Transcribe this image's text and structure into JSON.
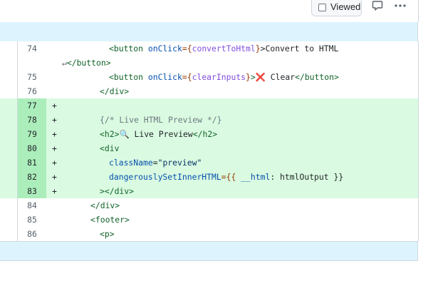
{
  "header": {
    "viewed_label": "Viewed",
    "comment_icon": "comment-icon",
    "kebab_icon": "kebab-horizontal-icon"
  },
  "colors": {
    "added_bg": "#dafbe1",
    "added_lineno_bg": "#aceebb",
    "hunk_bg": "#ddf4ff",
    "border": "#d0d7de"
  },
  "rows": [
    {
      "no": "74",
      "marker": "",
      "added": false,
      "tokens": [
        {
          "t": "<",
          "c": "tag"
        },
        {
          "t": "button",
          "c": "tag"
        },
        {
          "t": " onClick",
          "c": "attr"
        },
        {
          "t": "={",
          "c": "expr"
        },
        {
          "t": "convertToHtml",
          "c": "var"
        },
        {
          "t": "}",
          "c": "expr"
        },
        {
          "t": ">Convert to HTML",
          "c": "default"
        }
      ]
    },
    {
      "no": "",
      "marker": "",
      "added": false,
      "continuation": true,
      "tokens": [
        {
          "t": "↵",
          "c": "arrow"
        },
        {
          "t": "</button>",
          "c": "tag"
        }
      ]
    },
    {
      "no": "75",
      "marker": "",
      "added": false,
      "tokens": [
        {
          "t": "<",
          "c": "tag"
        },
        {
          "t": "button",
          "c": "tag"
        },
        {
          "t": " onClick",
          "c": "attr"
        },
        {
          "t": "={",
          "c": "expr"
        },
        {
          "t": "clearInputs",
          "c": "var"
        },
        {
          "t": "}",
          "c": "expr"
        },
        {
          "t": ">",
          "c": "tag"
        },
        {
          "t": "❌",
          "c": "red"
        },
        {
          "t": " Clear",
          "c": "default"
        },
        {
          "t": "</button>",
          "c": "tag"
        }
      ]
    },
    {
      "no": "76",
      "marker": "",
      "added": false,
      "tokens": [
        {
          "t": "</div>",
          "c": "tag"
        }
      ]
    },
    {
      "no": "77",
      "marker": "+",
      "added": true,
      "tokens": []
    },
    {
      "no": "78",
      "marker": "+",
      "added": true,
      "tokens": [
        {
          "t": "{/* Live HTML Preview */}",
          "c": "comment"
        }
      ]
    },
    {
      "no": "79",
      "marker": "+",
      "added": true,
      "tokens": [
        {
          "t": "<h2>",
          "c": "tag"
        },
        {
          "t": "🔍",
          "c": "default"
        },
        {
          "t": " Live Preview",
          "c": "default"
        },
        {
          "t": "</h2>",
          "c": "tag"
        }
      ]
    },
    {
      "no": "80",
      "marker": "+",
      "added": true,
      "tokens": [
        {
          "t": "<div",
          "c": "tag"
        }
      ]
    },
    {
      "no": "81",
      "marker": "+",
      "added": true,
      "tokens": [
        {
          "t": "className",
          "c": "attr"
        },
        {
          "t": "=",
          "c": "default"
        },
        {
          "t": "\"preview\"",
          "c": "str"
        }
      ]
    },
    {
      "no": "82",
      "marker": "+",
      "added": true,
      "tokens": [
        {
          "t": "dangerouslySetInnerHTML",
          "c": "attr"
        },
        {
          "t": "={{ ",
          "c": "expr"
        },
        {
          "t": "__html",
          "c": "attr"
        },
        {
          "t": ": htmlOutput }}",
          "c": "default"
        }
      ]
    },
    {
      "no": "83",
      "marker": "+",
      "added": true,
      "tokens": [
        {
          "t": "></div>",
          "c": "tag"
        }
      ]
    },
    {
      "no": "84",
      "marker": "",
      "added": false,
      "tokens": [
        {
          "t": "</div>",
          "c": "tag"
        }
      ]
    },
    {
      "no": "85",
      "marker": "",
      "added": false,
      "tokens": [
        {
          "t": "<footer>",
          "c": "tag"
        }
      ]
    },
    {
      "no": "86",
      "marker": "",
      "added": false,
      "tokens": [
        {
          "t": "<p>",
          "c": "tag"
        }
      ]
    }
  ]
}
